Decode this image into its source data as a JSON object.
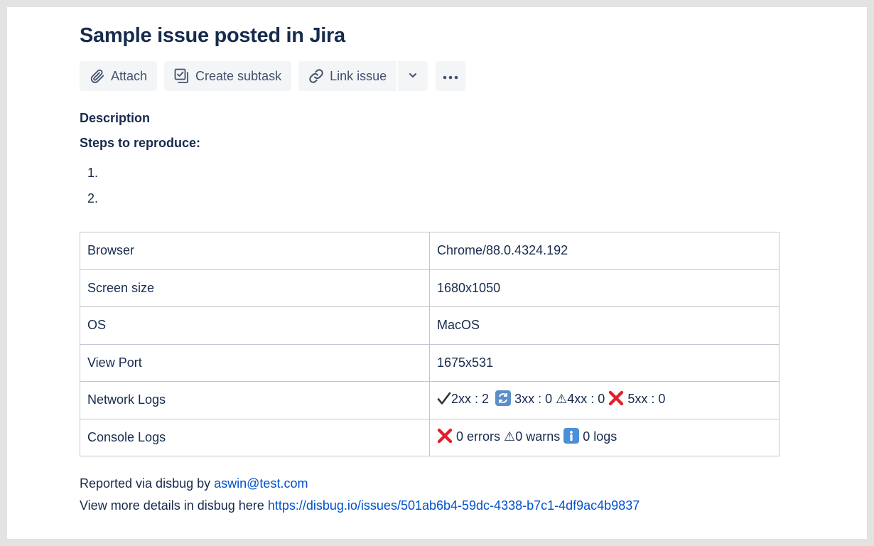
{
  "issue": {
    "title": "Sample issue posted in Jira"
  },
  "toolbar": {
    "attach_label": "Attach",
    "create_subtask_label": "Create subtask",
    "link_issue_label": "Link issue"
  },
  "description": {
    "label": "Description",
    "steps_heading": "Steps to reproduce:",
    "steps": [
      "1.",
      "2."
    ]
  },
  "details_table": {
    "rows": [
      {
        "key": "Browser",
        "value": "Chrome/88.0.4324.192"
      },
      {
        "key": "Screen size",
        "value": "1680x1050"
      },
      {
        "key": "OS",
        "value": "MacOS"
      },
      {
        "key": "View Port",
        "value": "1675x531"
      },
      {
        "key": "Network Logs"
      },
      {
        "key": "Console Logs"
      }
    ],
    "network_logs": {
      "ok": "2xx : 2",
      "redirect": "3xx : 0",
      "client_error_prefix": "⚠",
      "client_error": "4xx : 0",
      "server_error": "5xx : 0"
    },
    "console_logs": {
      "errors": "0 errors",
      "warns_prefix": "⚠",
      "warns": "0 warns",
      "logs": "0 logs"
    }
  },
  "footer": {
    "reported_prefix": "Reported via disbug by",
    "reporter_email": "aswin@test.com",
    "details_prefix": "View more details in disbug here",
    "details_url": "https://disbug.io/issues/501ab6b4-59dc-4338-b7c1-4df9ac4b9837"
  },
  "colors": {
    "heading": "#172b4d",
    "link": "#0052cc",
    "button_bg": "#f4f5f7",
    "error_red": "#e0202a",
    "info_blue": "#4a90d9"
  }
}
